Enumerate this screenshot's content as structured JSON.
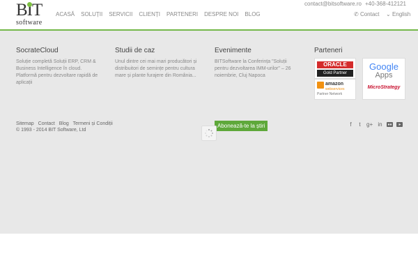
{
  "header": {
    "logo_letters": "BIT",
    "logo_word": "software",
    "nav": [
      "ACASĂ",
      "SOLUȚII",
      "SERVICII",
      "CLIENȚI",
      "PARTENERI",
      "DESPRE NOI",
      "BLOG"
    ],
    "email": "contact@bitsoftware.ro",
    "phone": "+40-368-412121",
    "contact_label": "Contact",
    "language_label": "English"
  },
  "footer": {
    "columns": [
      {
        "title": "SocrateCloud",
        "text": "Soluție completă Soluții ERP, CRM & Business Intelligence în cloud. Platformă pentru dezvoltare rapidă de aplicații"
      },
      {
        "title": "Studii de caz",
        "text": "Unul dintre cei mai mari producători și distribuitori de semințe pentru cultura mare și plante furajere din România..."
      },
      {
        "title": "Evenimente",
        "text": "BITSoftware la Conferința \"Soluții pentru dezvoltarea IMM-urilor\" – 26 noiembrie, Cluj Napoca"
      },
      {
        "title": "Parteneri",
        "text": ""
      }
    ],
    "partners": {
      "oracle": "ORACLE",
      "oracle_sub": "Gold Partner",
      "google": "Google",
      "google_apps": "Apps",
      "aws": "amazon",
      "aws_sub": "webservices",
      "aws_partner": "Partner Network",
      "microstrategy": "MicroStrategy"
    },
    "links": [
      "Sitemap",
      "Contact",
      "Blog",
      "Termeni și Condiții"
    ],
    "copyright": "© 1993 - 2014 BIT Software, Ltd",
    "subscribe_label": "Abonează-te la știri",
    "social_icons": [
      "facebook-icon",
      "twitter-icon",
      "google-plus-icon",
      "linkedin-icon",
      "flickr-icon",
      "youtube-icon"
    ]
  },
  "colors": {
    "accent_green": "#5ea83a",
    "footer_bg": "#e8e8e8"
  }
}
